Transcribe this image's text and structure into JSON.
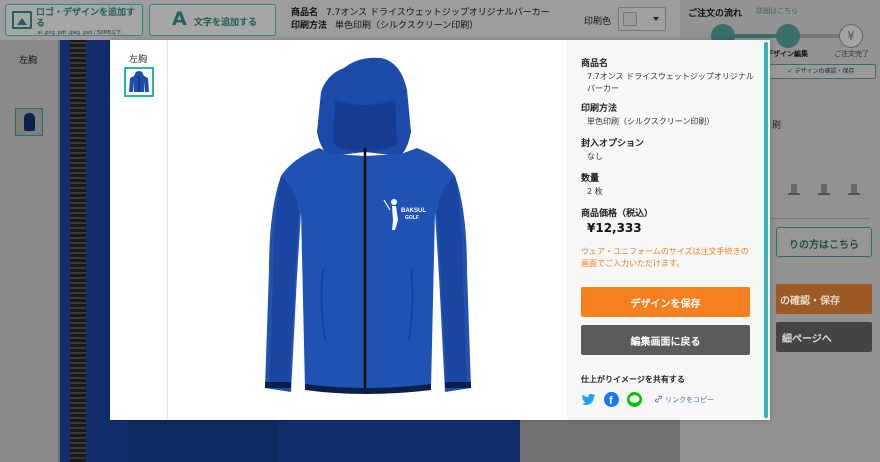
{
  "toolbar": {
    "logo_button_label": "ロゴ・デザインを追加する",
    "logo_button_sub": ".ai .png .pdf .jpeg .psd / 50MB以下",
    "text_button_label": "文字を追加する",
    "text_button_icon": "A",
    "product_name_label": "商品名",
    "product_name": "7.7オンス ドライスウェットジップオリジナルパーカー",
    "print_method_label": "印刷方法",
    "print_method": "単色印刷（シルクスクリーン印刷）",
    "print_color_label": "印刷色"
  },
  "left_panel": {
    "position_label": "左胸"
  },
  "order_flow": {
    "title": "ご注文の流れ",
    "detail_link": "詳細はこちら",
    "step2_label": "デザイン編集",
    "step3_label": "ご注文完了",
    "step3_icon": "¥",
    "confirm_tab": "✓ デザインの確認・保存",
    "print_partial": "刷",
    "size_help_button": "りの方はこちら",
    "confirm_save_button": "の確認・保存",
    "detail_page_button": "細ページへ"
  },
  "modal": {
    "position_label": "左胸",
    "print_text_line1": "BAKSUL",
    "print_text_line2": "GOLF",
    "info": {
      "product_name_label": "商品名",
      "product_name": "7.7オンス ドライスウェットジップオリジナルパーカー",
      "print_method_label": "印刷方法",
      "print_method": "単色印刷（シルクスクリーン印刷）",
      "packaging_label": "封入オプション",
      "packaging_value": "なし",
      "quantity_label": "数量",
      "quantity_value": "2 枚",
      "price_label": "商品価格（税込）",
      "price_value": "¥12,333",
      "size_note": "ウェア・ユニフォームのサイズは注文手続きの画面でご入力いただけます。",
      "save_button": "デザインを保存",
      "back_button": "編集画面に戻る",
      "share_label": "仕上がりイメージを共有する",
      "copy_link": "リンクをコピー"
    }
  },
  "colors": {
    "accent": "#f5801f",
    "teal": "#2bb3b0",
    "hoodie_blue": "#1f4fad",
    "twitter": "#1da1f2",
    "facebook": "#1877f2",
    "line": "#00c300"
  },
  "icons": [
    "image-icon",
    "text-a-icon",
    "gift-icon",
    "pencil-icon",
    "yen-icon",
    "twitter-icon",
    "facebook-icon",
    "line-icon",
    "link-icon"
  ]
}
